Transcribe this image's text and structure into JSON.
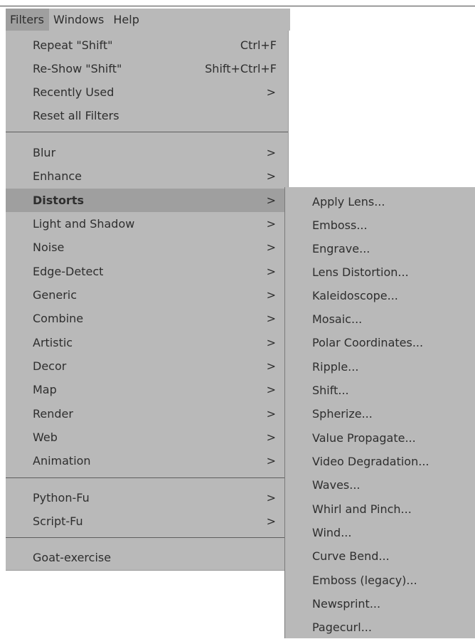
{
  "menubar": {
    "items": [
      "Filters",
      "Windows",
      "Help"
    ]
  },
  "filters_menu": {
    "top_items": [
      {
        "label": "Repeat \"Shift\"",
        "shortcut": "Ctrl+F"
      },
      {
        "label": "Re-Show \"Shift\"",
        "shortcut": "Shift+Ctrl+F"
      },
      {
        "label": "Recently Used",
        "arrow": ">"
      },
      {
        "label": "Reset all Filters"
      }
    ],
    "category_items": [
      {
        "label": "Blur",
        "arrow": ">"
      },
      {
        "label": "Enhance",
        "arrow": ">"
      },
      {
        "label": "Distorts",
        "arrow": ">"
      },
      {
        "label": "Light and Shadow",
        "arrow": ">"
      },
      {
        "label": "Noise",
        "arrow": ">"
      },
      {
        "label": "Edge-Detect",
        "arrow": ">"
      },
      {
        "label": "Generic",
        "arrow": ">"
      },
      {
        "label": "Combine",
        "arrow": ">"
      },
      {
        "label": "Artistic",
        "arrow": ">"
      },
      {
        "label": "Decor",
        "arrow": ">"
      },
      {
        "label": "Map",
        "arrow": ">"
      },
      {
        "label": "Render",
        "arrow": ">"
      },
      {
        "label": "Web",
        "arrow": ">"
      },
      {
        "label": "Animation",
        "arrow": ">"
      }
    ],
    "script_items": [
      {
        "label": "Python-Fu",
        "arrow": ">"
      },
      {
        "label": "Script-Fu",
        "arrow": ">"
      }
    ],
    "bottom_items": [
      {
        "label": "Goat-exercise"
      }
    ]
  },
  "distorts_submenu": {
    "items": [
      "Apply Lens...",
      "Emboss...",
      "Engrave...",
      "Lens Distortion...",
      "Kaleidoscope...",
      "Mosaic...",
      "Polar Coordinates...",
      "Ripple...",
      "Shift...",
      "Spherize...",
      "Value Propagate...",
      "Video Degradation...",
      "Waves...",
      "Whirl and Pinch...",
      "Wind...",
      "Curve Bend...",
      "Emboss (legacy)...",
      "Newsprint...",
      "Pagecurl..."
    ]
  },
  "colors": {
    "menu_bg": "#b9b9b9",
    "highlight_bg": "#9f9f9f",
    "text": "#2e2e2e",
    "separator": "#5e5e5e"
  }
}
